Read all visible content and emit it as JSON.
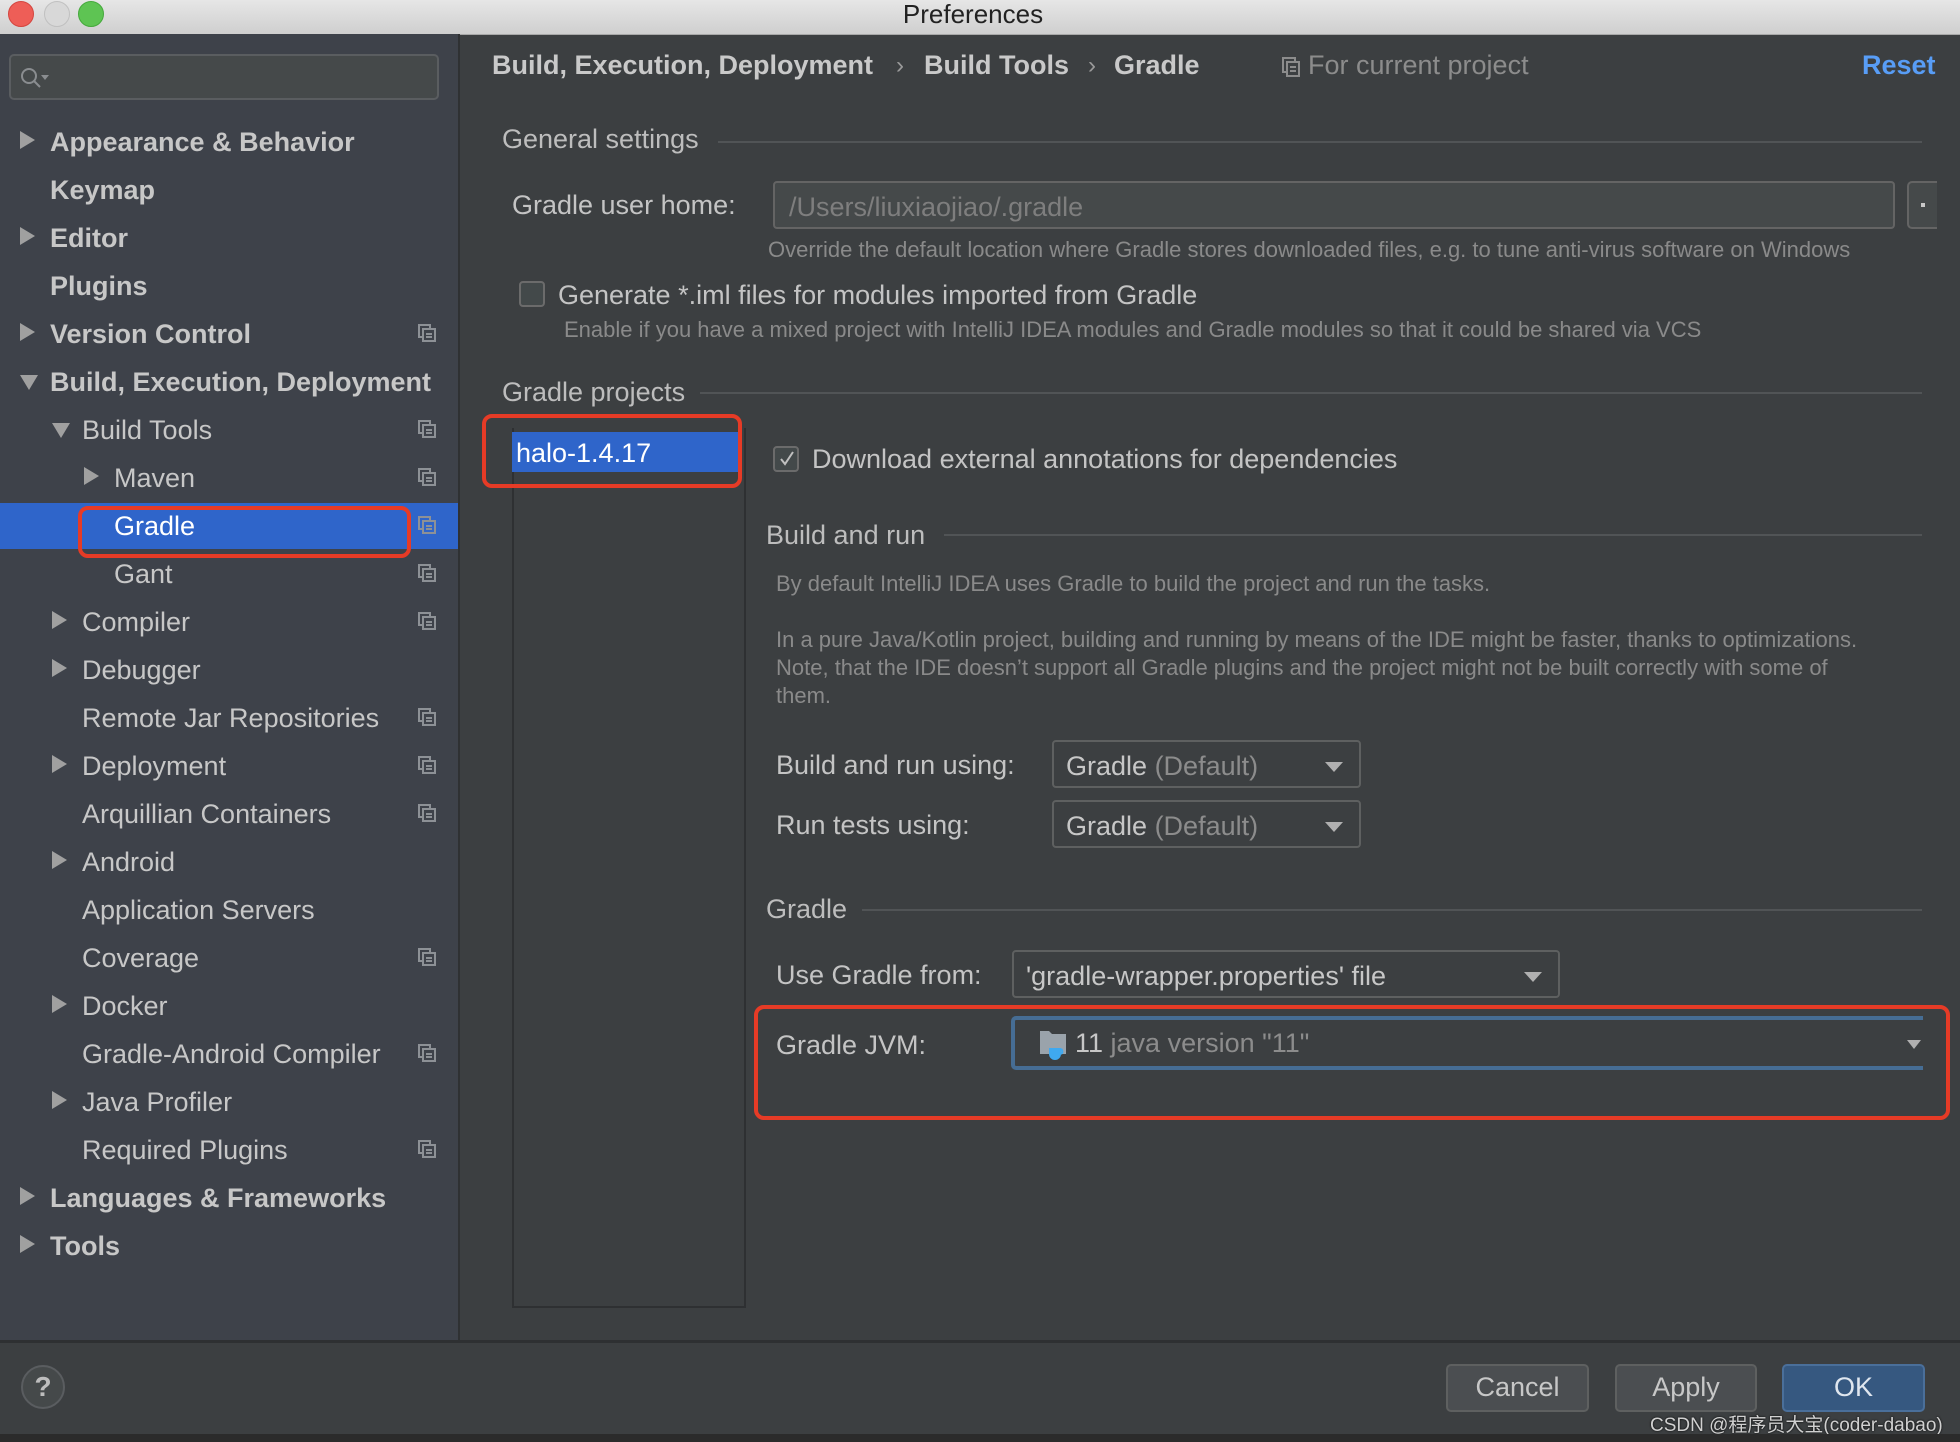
{
  "window": {
    "title": "Preferences"
  },
  "sidebar": {
    "search_placeholder": "",
    "items": [
      {
        "label": "Appearance & Behavior",
        "level": 0,
        "expander": "collapsed",
        "bold": true,
        "project_icon": false
      },
      {
        "label": "Keymap",
        "level": 0,
        "expander": "none",
        "bold": true,
        "project_icon": false
      },
      {
        "label": "Editor",
        "level": 0,
        "expander": "collapsed",
        "bold": true,
        "project_icon": false
      },
      {
        "label": "Plugins",
        "level": 0,
        "expander": "none",
        "bold": true,
        "project_icon": false
      },
      {
        "label": "Version Control",
        "level": 0,
        "expander": "collapsed",
        "bold": true,
        "project_icon": true
      },
      {
        "label": "Build, Execution, Deployment",
        "level": 0,
        "expander": "expanded",
        "bold": true,
        "project_icon": false
      },
      {
        "label": "Build Tools",
        "level": 1,
        "expander": "expanded",
        "bold": false,
        "project_icon": true
      },
      {
        "label": "Maven",
        "level": 2,
        "expander": "collapsed",
        "bold": false,
        "project_icon": true
      },
      {
        "label": "Gradle",
        "level": 2,
        "expander": "none",
        "bold": false,
        "project_icon": true,
        "selected": true
      },
      {
        "label": "Gant",
        "level": 2,
        "expander": "none",
        "bold": false,
        "project_icon": true
      },
      {
        "label": "Compiler",
        "level": 1,
        "expander": "collapsed",
        "bold": false,
        "project_icon": true
      },
      {
        "label": "Debugger",
        "level": 1,
        "expander": "collapsed",
        "bold": false,
        "project_icon": false
      },
      {
        "label": "Remote Jar Repositories",
        "level": 1,
        "expander": "none",
        "bold": false,
        "project_icon": true
      },
      {
        "label": "Deployment",
        "level": 1,
        "expander": "collapsed",
        "bold": false,
        "project_icon": true
      },
      {
        "label": "Arquillian Containers",
        "level": 1,
        "expander": "none",
        "bold": false,
        "project_icon": true
      },
      {
        "label": "Android",
        "level": 1,
        "expander": "collapsed",
        "bold": false,
        "project_icon": false
      },
      {
        "label": "Application Servers",
        "level": 1,
        "expander": "none",
        "bold": false,
        "project_icon": false
      },
      {
        "label": "Coverage",
        "level": 1,
        "expander": "none",
        "bold": false,
        "project_icon": true
      },
      {
        "label": "Docker",
        "level": 1,
        "expander": "collapsed",
        "bold": false,
        "project_icon": false
      },
      {
        "label": "Gradle-Android Compiler",
        "level": 1,
        "expander": "none",
        "bold": false,
        "project_icon": true
      },
      {
        "label": "Java Profiler",
        "level": 1,
        "expander": "collapsed",
        "bold": false,
        "project_icon": false
      },
      {
        "label": "Required Plugins",
        "level": 1,
        "expander": "none",
        "bold": false,
        "project_icon": true
      },
      {
        "label": "Languages & Frameworks",
        "level": 0,
        "expander": "collapsed",
        "bold": true,
        "project_icon": false
      },
      {
        "label": "Tools",
        "level": 0,
        "expander": "collapsed",
        "bold": true,
        "project_icon": false
      }
    ]
  },
  "header": {
    "breadcrumb": [
      "Build, Execution, Deployment",
      "Build Tools",
      "Gradle"
    ],
    "breadcrumb_separator": "›",
    "scope_label": "For current project",
    "reset_label": "Reset"
  },
  "general_settings": {
    "title": "General settings",
    "gradle_user_home_label": "Gradle user home:",
    "gradle_user_home_value": "/Users/liuxiaojiao/.gradle",
    "gradle_user_home_hint": "Override the default location where Gradle stores downloaded files, e.g. to tune anti-virus software on Windows",
    "browse_label": ".",
    "generate_iml_label": "Generate *.iml files for modules imported from Gradle",
    "generate_iml_checked": false,
    "generate_iml_hint": "Enable if you have a mixed project with IntelliJ IDEA modules and Gradle modules so that it could be shared via VCS"
  },
  "gradle_projects": {
    "title": "Gradle projects",
    "projects": [
      "halo-1.4.17"
    ],
    "download_annotations_label": "Download external annotations for dependencies",
    "download_annotations_checked": true
  },
  "build_and_run": {
    "title": "Build and run",
    "description_1": "By default IntelliJ IDEA uses Gradle to build the project and run the tasks.",
    "description_2": "In a pure Java/Kotlin project, building and running by means of the IDE might be faster, thanks to optimizations.",
    "description_3": "Note, that the IDE doesn’t support all Gradle plugins and the project might not be built correctly with some of",
    "description_4": "them.",
    "build_run_using_label": "Build and run using:",
    "build_run_using_value": "Gradle",
    "build_run_using_suffix": "(Default)",
    "run_tests_using_label": "Run tests using:",
    "run_tests_using_value": "Gradle",
    "run_tests_using_suffix": "(Default)"
  },
  "gradle": {
    "title": "Gradle",
    "use_gradle_from_label": "Use Gradle from:",
    "use_gradle_from_value": "'gradle-wrapper.properties' file",
    "gradle_jvm_label": "Gradle JVM:",
    "gradle_jvm_version": "11",
    "gradle_jvm_detail": "java version \"11\""
  },
  "footer": {
    "help_label": "?",
    "cancel_label": "Cancel",
    "apply_label": "Apply",
    "ok_label": "OK"
  },
  "watermark": "CSDN @程序员大宝(coder-dabao)",
  "colors": {
    "selection": "#2f65ca",
    "accent_link": "#589df6",
    "highlight_box": "#e63b26",
    "primary_button": "#365880"
  }
}
